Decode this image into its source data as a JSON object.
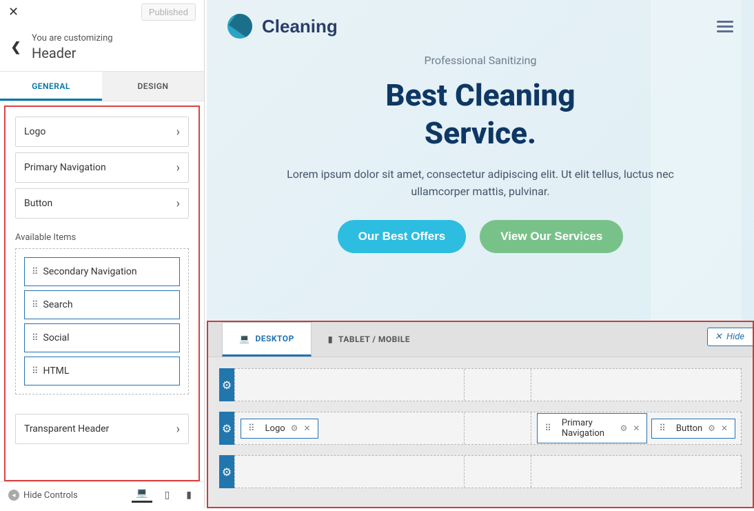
{
  "sidebar": {
    "published": "Published",
    "crumb_label": "You are customizing",
    "crumb_title": "Header",
    "tabs": {
      "general": "GENERAL",
      "design": "DESIGN"
    },
    "items": [
      "Logo",
      "Primary Navigation",
      "Button"
    ],
    "avail_label": "Available Items",
    "avail": [
      "Secondary Navigation",
      "Search",
      "Social",
      "HTML"
    ],
    "transparent": "Transparent Header",
    "hide_controls": "Hide Controls"
  },
  "preview": {
    "brand": "Cleaning",
    "subtitle": "Professional Sanitizing",
    "title_line1": "Best Cleaning",
    "title_line2": "Service.",
    "text": "Lorem ipsum dolor sit amet, consectetur adipiscing elit. Ut elit tellus, luctus nec ullamcorper mattis, pulvinar.",
    "btn1": "Our Best Offers",
    "btn2": "View Our Services"
  },
  "builder": {
    "tabs": {
      "desktop": "DESKTOP",
      "tablet": "TABLET / MOBILE"
    },
    "hide": "Hide",
    "row2_left": [
      "Logo"
    ],
    "row2_right": [
      "Primary Navigation",
      "Button"
    ]
  }
}
